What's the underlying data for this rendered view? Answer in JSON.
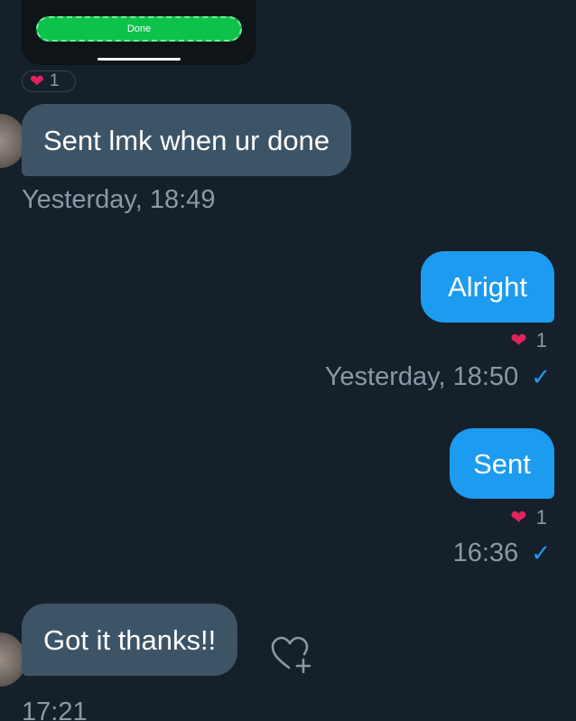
{
  "top_card": {
    "done_label": "Done"
  },
  "top_reaction": {
    "emoji": "❤️",
    "count": "1"
  },
  "messages": [
    {
      "direction": "incoming",
      "text": "Sent lmk when ur done",
      "timestamp": "Yesterday, 18:49"
    },
    {
      "direction": "outgoing",
      "text": "Alright",
      "reaction_emoji": "❤️",
      "reaction_count": "1",
      "timestamp": "Yesterday, 18:50",
      "status_icon": "check-icon"
    },
    {
      "direction": "outgoing",
      "text": "Sent",
      "reaction_emoji": "❤️",
      "reaction_count": "1",
      "timestamp": "16:36",
      "status_icon": "check-icon"
    },
    {
      "direction": "incoming",
      "text": "Got it thanks!!",
      "timestamp": "17:21",
      "action_icon": "add-reaction-icon"
    }
  ],
  "colors": {
    "background": "#15202b",
    "incoming_bubble": "#3d5466",
    "outgoing_bubble": "#1d9bf0",
    "timestamp_text": "#8b98a5",
    "heart": "#e0245e",
    "done_button": "#0dc24a"
  },
  "icons": {
    "check": "✓",
    "heart": "❤"
  }
}
